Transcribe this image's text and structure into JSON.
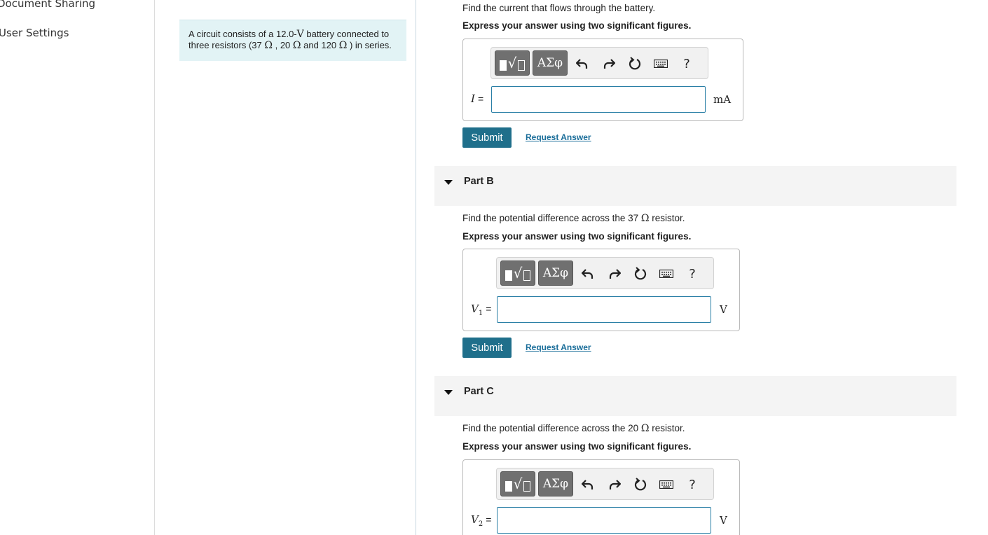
{
  "nav": {
    "items": [
      {
        "label": "Document Sharing"
      },
      {
        "label": "User Settings"
      }
    ]
  },
  "intro": {
    "line1_a": "A circuit consists of a 12.0-",
    "line1_v": "V",
    "line1_b": " battery connected to",
    "line2_a": "three resistors (37 ",
    "line2_o1": "Ω",
    "line2_b": " , 20 ",
    "line2_o2": "Ω",
    "line2_c": " and 120 ",
    "line2_o3": "Ω",
    "line2_d": " ) in series."
  },
  "toolbar": {
    "greek_label": "ΑΣφ",
    "help_label": "?"
  },
  "partA": {
    "prompt": "Find the current that flows through the battery.",
    "instruction": "Express your answer using two significant figures.",
    "variable": "I",
    "equals": "=",
    "unit": "mA",
    "input_value": "",
    "submit_label": "Submit",
    "request_label": "Request Answer"
  },
  "partB": {
    "title": "Part B",
    "prompt_a": "Find the potential difference across the 37 ",
    "prompt_omega": "Ω",
    "prompt_b": " resistor.",
    "instruction": "Express your answer using two significant figures.",
    "variable": "V",
    "subscript": "1",
    "equals": "=",
    "unit": "V",
    "input_value": "",
    "submit_label": "Submit",
    "request_label": "Request Answer"
  },
  "partC": {
    "title": "Part C",
    "prompt_a": "Find the potential difference across the 20 ",
    "prompt_omega": "Ω",
    "prompt_b": " resistor.",
    "instruction": "Express your answer using two significant figures.",
    "variable": "V",
    "subscript": "2",
    "equals": "=",
    "unit": "V",
    "input_value": ""
  }
}
